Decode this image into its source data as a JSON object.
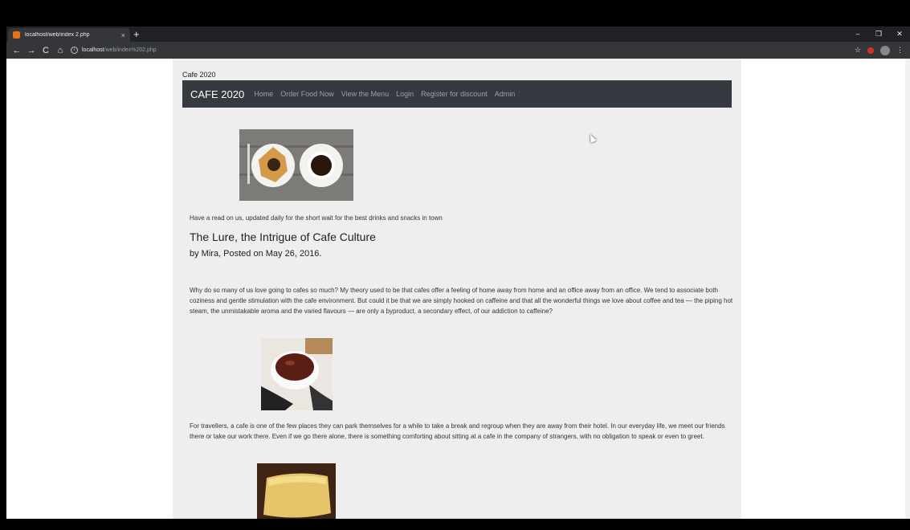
{
  "browser": {
    "tab_title": "localhost/web/index 2.php",
    "tab_close": "×",
    "new_tab": "+",
    "url_host": "localhost",
    "url_path": "/web/index%202.php",
    "controls": {
      "minimize": "–",
      "maximize": "❐",
      "close": "✕"
    },
    "nav": {
      "back": "←",
      "forward": "→",
      "reload": "C",
      "home": "⌂"
    },
    "info": "i",
    "star": "☆",
    "menu": "⋮"
  },
  "site": {
    "label": "Cafe 2020",
    "brand": "CAFE 2020",
    "nav": [
      "Home",
      "Order Food Now",
      "View the Menu",
      "Login",
      "Register for discount",
      "Admin"
    ]
  },
  "article": {
    "tagline": "Have a read on us, updated daily for the short wait for the best drinks and snacks in town",
    "title": "The Lure, the Intrigue of Cafe Culture",
    "byline": "by Mira, Posted on May 26, 2016.",
    "paragraph1": "Why do so many of us love going to cafes so much? My theory used to be that cafes offer a feeling of home away from home and an office away from an office. We tend to associate both coziness and gentle stimulation with the cafe environment. But could it be that we are simply hooked on caffeine and that all the wonderful things we love about coffee and tea — the piping hot steam, the unmistakable aroma and the varied flavours — are only a byproduct, a secondary effect, of our addiction to caffeine?",
    "paragraph2": "For travellers, a cafe is one of the few places they can park themselves for a while to take a break and regroup when they are away from their hotel. In our everyday life, we meet our friends there or take our work there. Even if we go there alone, there is something comforting about sitting at a cafe in the company of strangers, with no obligation to speak or even to greet."
  },
  "colors": {
    "navbar": "#343a40",
    "page_bg": "#eeeeef",
    "accent": "#e8711a"
  }
}
